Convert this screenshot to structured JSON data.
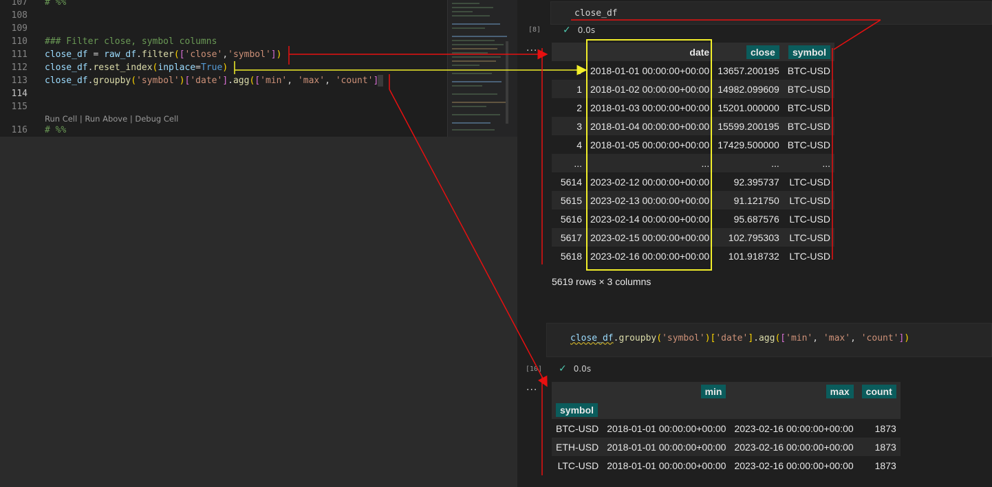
{
  "editor": {
    "lines": [
      {
        "num": "107",
        "text": "# %%"
      },
      {
        "num": "108",
        "text": ""
      },
      {
        "num": "109",
        "text": ""
      },
      {
        "num": "110",
        "text": "### Filter close, symbol columns"
      },
      {
        "num": "111",
        "text": "close_df = raw_df.filter(['close','symbol'])"
      },
      {
        "num": "112",
        "text": "close_df.reset_index(inplace=True)"
      },
      {
        "num": "113",
        "text": "close_df.groupby('symbol')['date'].agg(['min', 'max', 'count'])"
      },
      {
        "num": "114",
        "text": ""
      },
      {
        "num": "115",
        "text": ""
      },
      {
        "num": "116",
        "text": "# %%"
      }
    ],
    "codelens": {
      "run_cell": "Run Cell",
      "run_above": "Run Above",
      "debug_cell": "Debug Cell",
      "separator": " | "
    }
  },
  "cell1": {
    "exec_count": "[8]",
    "code": "close_df",
    "status_time": "0.0s",
    "more": "...",
    "columns": [
      "date",
      "close",
      "symbol"
    ],
    "rows": [
      {
        "idx": "0",
        "date": "2018-01-01 00:00:00+00:00",
        "close": "13657.200195",
        "symbol": "BTC-USD"
      },
      {
        "idx": "1",
        "date": "2018-01-02 00:00:00+00:00",
        "close": "14982.099609",
        "symbol": "BTC-USD"
      },
      {
        "idx": "2",
        "date": "2018-01-03 00:00:00+00:00",
        "close": "15201.000000",
        "symbol": "BTC-USD"
      },
      {
        "idx": "3",
        "date": "2018-01-04 00:00:00+00:00",
        "close": "15599.200195",
        "symbol": "BTC-USD"
      },
      {
        "idx": "4",
        "date": "2018-01-05 00:00:00+00:00",
        "close": "17429.500000",
        "symbol": "BTC-USD"
      },
      {
        "idx": "...",
        "date": "...",
        "close": "...",
        "symbol": "..."
      },
      {
        "idx": "5614",
        "date": "2023-02-12 00:00:00+00:00",
        "close": "92.395737",
        "symbol": "LTC-USD"
      },
      {
        "idx": "5615",
        "date": "2023-02-13 00:00:00+00:00",
        "close": "91.121750",
        "symbol": "LTC-USD"
      },
      {
        "idx": "5616",
        "date": "2023-02-14 00:00:00+00:00",
        "close": "95.687576",
        "symbol": "LTC-USD"
      },
      {
        "idx": "5617",
        "date": "2023-02-15 00:00:00+00:00",
        "close": "102.795303",
        "symbol": "LTC-USD"
      },
      {
        "idx": "5618",
        "date": "2023-02-16 00:00:00+00:00",
        "close": "101.918732",
        "symbol": "LTC-USD"
      }
    ],
    "shape": "5619 rows × 3 columns"
  },
  "cell2": {
    "exec_count": "[10]",
    "code": "close_df.groupby('symbol')['date'].agg(['min', 'max', 'count'])",
    "status_time": "0.0s",
    "more": "...",
    "columns": [
      "min",
      "max",
      "count"
    ],
    "index_name": "symbol",
    "rows": [
      {
        "idx": "BTC-USD",
        "min": "2018-01-01 00:00:00+00:00",
        "max": "2023-02-16 00:00:00+00:00",
        "count": "1873"
      },
      {
        "idx": "ETH-USD",
        "min": "2018-01-01 00:00:00+00:00",
        "max": "2023-02-16 00:00:00+00:00",
        "count": "1873"
      },
      {
        "idx": "LTC-USD",
        "min": "2018-01-01 00:00:00+00:00",
        "max": "2023-02-16 00:00:00+00:00",
        "count": "1873"
      }
    ]
  },
  "colors": {
    "annotation_red": "#e81010",
    "annotation_yellow": "#f2ef2a",
    "tag_teal": "#0b5c5c"
  }
}
